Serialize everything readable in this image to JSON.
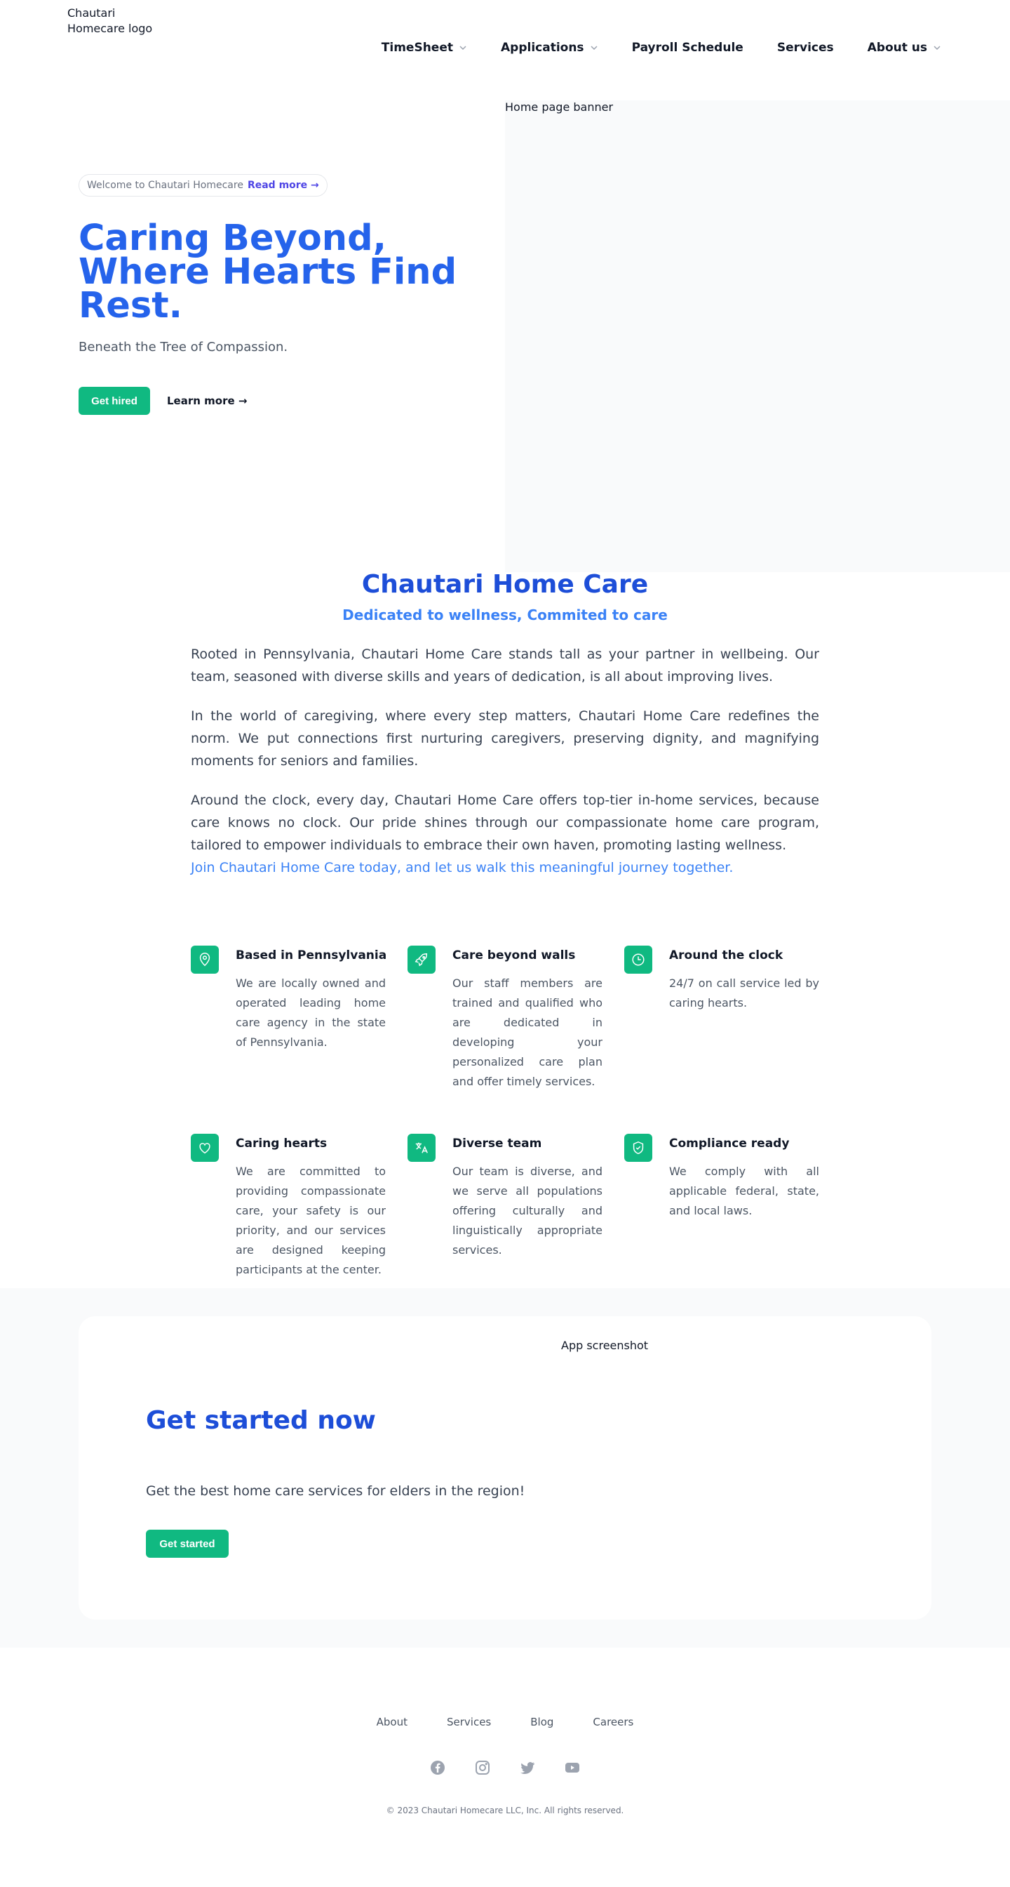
{
  "header": {
    "logo_alt": "Chautari Homecare logo",
    "nav": [
      {
        "label": "TimeSheet"
      },
      {
        "label": "Applications"
      },
      {
        "label": "Payroll Schedule"
      },
      {
        "label": "Services"
      },
      {
        "label": "About us"
      }
    ]
  },
  "hero": {
    "banner_alt": "Home page banner",
    "pill_text": "Welcome to Chautari Homecare",
    "pill_link": "Read more →",
    "title": "Caring Beyond, Where Hearts Find Rest.",
    "subtitle": "Beneath the Tree of Compassion.",
    "primary_button": "Get hired",
    "secondary_link": "Learn more →"
  },
  "about": {
    "title": "Chautari Home Care",
    "tagline": "Dedicated to wellness, Commited to care",
    "paragraphs": [
      "Rooted in Pennsylvania, Chautari Home Care stands tall as your partner in wellbeing. Our team, seasoned with diverse skills and years of dedication, is all about improving lives.",
      "In the world of caregiving, where every step matters, Chautari Home Care redefines the norm. We put connections first nurturing caregivers, preserving dignity, and magnifying moments for seniors and families.",
      "Around the clock, every day, Chautari Home Care offers top-tier in-home services, because care knows no clock. Our pride shines through our compassionate home care program, tailored to empower individuals to embrace their own haven, promoting lasting wellness."
    ],
    "cta": "Join Chautari Home Care today, and let us walk this meaningful journey together."
  },
  "features": [
    {
      "icon": "location-pin-icon",
      "title": "Based in Pennsylvania",
      "text": "We are locally owned and operated leading home care agency in the state of Pennsylvania."
    },
    {
      "icon": "rocket-icon",
      "title": "Care beyond walls",
      "text": "Our staff members are trained and qualified who are dedicated in developing your personalized care plan and offer timely services."
    },
    {
      "icon": "clock-icon",
      "title": "Around the clock",
      "text": "24/7 on call service led by caring hearts."
    },
    {
      "icon": "heart-icon",
      "title": "Caring hearts",
      "text": "We are committed to providing compassionate care, your safety is our priority, and our services are designed keeping participants at the center."
    },
    {
      "icon": "translate-icon",
      "title": "Diverse team",
      "text": "Our team is diverse, and we serve all populations offering culturally and linguistically appropriate services."
    },
    {
      "icon": "shield-check-icon",
      "title": "Compliance ready",
      "text": "We comply with all applicable federal, state, and local laws."
    }
  ],
  "cta": {
    "image_alt": "App screenshot",
    "title": "Get started now",
    "subtitle": "Get the best home care services for elders in the region!",
    "button": "Get started"
  },
  "footer": {
    "links": [
      "About",
      "Services",
      "Blog",
      "Careers"
    ],
    "socials": [
      "facebook-icon",
      "instagram-icon",
      "twitter-icon",
      "youtube-icon"
    ],
    "copyright": "© 2023 Chautari Homecare LLC, Inc. All rights reserved."
  },
  "colors": {
    "brand_blue": "#2563eb",
    "heading_blue": "#1d4ed8",
    "accent_green": "#10b981",
    "light_bg": "#f9fafb"
  }
}
